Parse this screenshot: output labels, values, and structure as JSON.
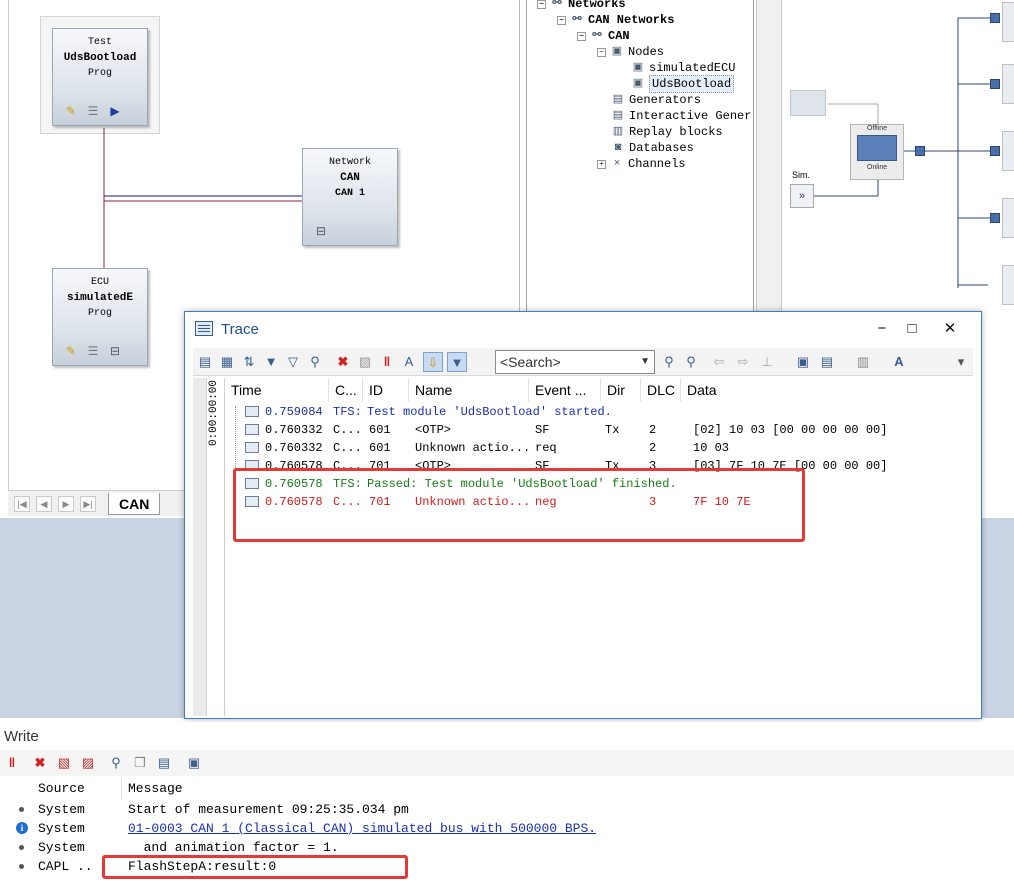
{
  "canvas": {
    "nodes": {
      "test": {
        "line1": "Test",
        "line2": "UdsBootload",
        "line3": "Prog"
      },
      "network": {
        "line1": "Network",
        "line2": "CAN",
        "line3": "CAN 1"
      },
      "ecu": {
        "line1": "ECU",
        "line2": "simulatedE",
        "line3": "Prog"
      }
    },
    "tab_label": "CAN"
  },
  "tree": {
    "items": [
      {
        "label": "Networks",
        "icon": "network-icon"
      },
      {
        "label": "CAN Networks",
        "icon": "network-icon"
      },
      {
        "label": "CAN",
        "icon": "network-icon"
      },
      {
        "label": "Nodes",
        "icon": "node-icon"
      },
      {
        "label": "simulatedECU",
        "icon": "node-icon"
      },
      {
        "label": "UdsBootload",
        "icon": "node-icon"
      },
      {
        "label": "Generators",
        "icon": "generator-icon"
      },
      {
        "label": "Interactive Gener",
        "icon": "generator-icon"
      },
      {
        "label": "Replay blocks",
        "icon": "replay-icon"
      },
      {
        "label": "Databases",
        "icon": "database-icon"
      },
      {
        "label": "Channels",
        "icon": "channel-icon"
      }
    ]
  },
  "network_diagram": {
    "offline_label": "Offline",
    "online_label": "Online",
    "sim_label": "Sim."
  },
  "trace": {
    "title": "Trace",
    "search_placeholder": "<Search>",
    "time_strip": "0:00:00:00",
    "columns": [
      "Time",
      "C...",
      "ID",
      "Name",
      "Event ...",
      "Dir",
      "DLC",
      "Data"
    ],
    "rows": [
      {
        "time": "0.759084",
        "chan": "TFS:",
        "id": "",
        "name": "Test module 'UdsBootload' started.",
        "event": "",
        "dir": "",
        "dlc": "",
        "data": "",
        "style": "blue"
      },
      {
        "time": "0.760332",
        "chan": "C...",
        "id": "601",
        "name": "<OTP>",
        "event": "SF",
        "dir": "Tx",
        "dlc": "2",
        "data": "[02] 10 03 [00 00 00 00 00]",
        "style": "black"
      },
      {
        "time": "0.760332",
        "chan": "C...",
        "id": "601",
        "name": "Unknown actio...",
        "event": "req",
        "dir": "",
        "dlc": "2",
        "data": "10 03",
        "style": "black"
      },
      {
        "time": "0.760578",
        "chan": "C...",
        "id": "701",
        "name": "<OTP>",
        "event": "SF",
        "dir": "Tx",
        "dlc": "3",
        "data": "[03] 7F 10 7E [00 00 00 00]",
        "style": "black"
      },
      {
        "time": "0.760578",
        "chan": "TFS:",
        "id": "",
        "name": "Passed: Test module 'UdsBootload' finished.",
        "event": "",
        "dir": "",
        "dlc": "",
        "data": "",
        "style": "green"
      },
      {
        "time": "0.760578",
        "chan": "C...",
        "id": "701",
        "name": "Unknown actio...",
        "event": "neg",
        "dir": "",
        "dlc": "3",
        "data": "7F 10 7E",
        "style": "red"
      }
    ]
  },
  "write": {
    "title": "Write",
    "columns": [
      "Source",
      "Message"
    ],
    "rows": [
      {
        "source": "System",
        "message": "Start of measurement 09:25:35.034 pm",
        "icon": "bullet",
        "link": false
      },
      {
        "source": "System",
        "message": "01-0003 CAN 1 (Classical CAN)  simulated bus with 500000 BPS.",
        "icon": "info",
        "link": true
      },
      {
        "source": "System",
        "message": "  and animation factor = 1.",
        "icon": "bullet",
        "link": false
      },
      {
        "source": "CAPL ..",
        "message": "FlashStepA:result:0",
        "icon": "bullet",
        "link": false
      }
    ]
  },
  "colors": {
    "highlight": "#e53935",
    "trace_blue": "#1a2fb0",
    "trace_green": "#157b15",
    "trace_red": "#d21a1a"
  }
}
